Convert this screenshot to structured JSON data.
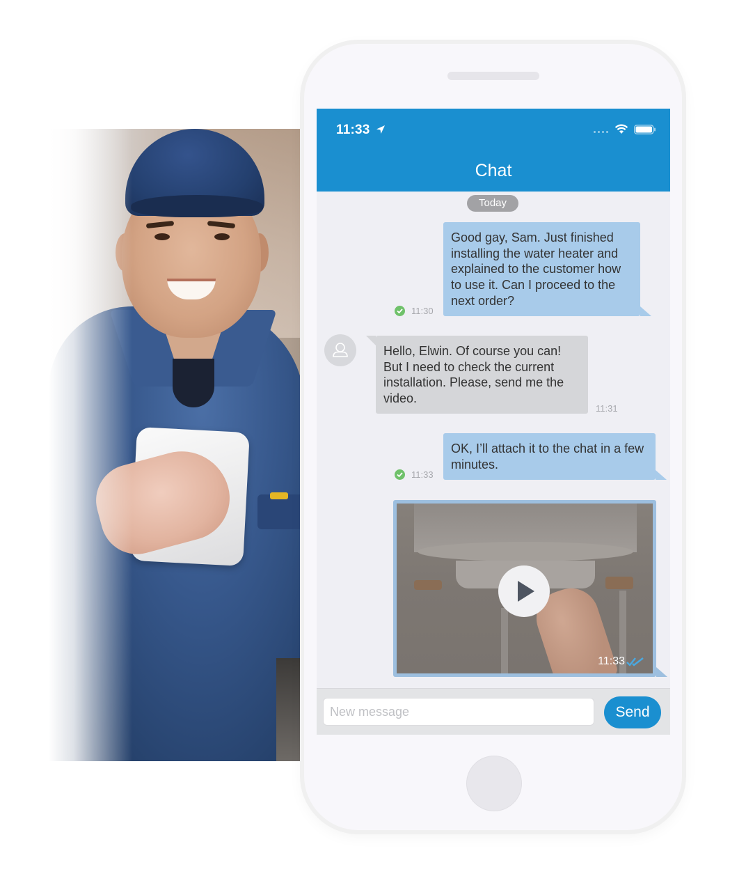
{
  "status_bar": {
    "time": "11:33",
    "icons": [
      "location-arrow-icon",
      "signal-dots-icon",
      "wifi-icon",
      "battery-icon"
    ]
  },
  "header": {
    "title": "Chat",
    "background_color": "#1a8fd0"
  },
  "chat": {
    "date_separator": "Today",
    "messages": [
      {
        "direction": "outgoing",
        "text": "Good gay, Sam. Just finished installing the water heater and explained to the customer how to use it. Can I proceed to the next order?",
        "time": "11:30",
        "status_icon": "delivered-check-icon"
      },
      {
        "direction": "incoming",
        "sender_avatar": "user-avatar-icon",
        "text": "Hello, Elwin. Of course you can! But I need to check the current installation. Please, send me the video.",
        "time": "11:31"
      },
      {
        "direction": "outgoing",
        "text": "OK, I’ll attach it to the chat in a few minutes.",
        "time": "11:33",
        "status_icon": "delivered-check-icon"
      },
      {
        "direction": "outgoing",
        "type": "video",
        "thumbnail": "water-heater-video-thumbnail",
        "time": "11:33",
        "status_icon": "double-check-read-icon"
      }
    ],
    "colors": {
      "outgoing_bubble": "#a8cbea",
      "incoming_bubble": "#d5d6d9",
      "delivered": "#6fc16a",
      "read_tick": "#4aa8e0"
    }
  },
  "composer": {
    "placeholder": "New message",
    "value": "",
    "send_label": "Send"
  },
  "photo": {
    "subject": "smiling-technician-holding-tablet"
  }
}
